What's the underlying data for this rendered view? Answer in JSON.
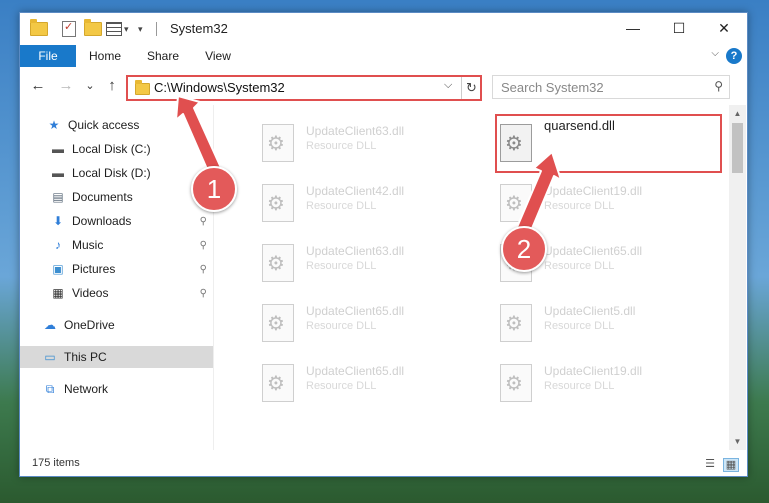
{
  "window": {
    "title": "System32"
  },
  "window_controls": {
    "minimize": "—",
    "maximize": "☐",
    "close": "✕"
  },
  "ribbon": {
    "tabs": [
      {
        "label": "File"
      },
      {
        "label": "Home"
      },
      {
        "label": "Share"
      },
      {
        "label": "View"
      }
    ],
    "help": "?",
    "expand": "⌵"
  },
  "nav": {
    "back": "←",
    "forward": "→",
    "recent": "⌄",
    "up": "↑",
    "address": "C:\\Windows\\System32",
    "dropdown": "⌵",
    "refresh": "↻",
    "search_placeholder": "Search System32",
    "search_icon": "⚲"
  },
  "sidebar": {
    "items": [
      {
        "label": "Quick access",
        "icon": "star-icon",
        "glyph": "★",
        "color": "#2f7ed8",
        "pinned": false,
        "selected": false
      },
      {
        "label": "Local Disk (C:)",
        "icon": "drive-icon",
        "glyph": "▬",
        "color": "#555555",
        "pinned": true,
        "selected": false
      },
      {
        "label": "Local Disk (D:)",
        "icon": "drive-icon",
        "glyph": "▬",
        "color": "#555555",
        "pinned": false,
        "selected": false
      },
      {
        "label": "Documents",
        "icon": "documents-icon",
        "glyph": "▤",
        "color": "#5b6a7a",
        "pinned": true,
        "selected": false
      },
      {
        "label": "Downloads",
        "icon": "downloads-icon",
        "glyph": "⬇",
        "color": "#2f7ed8",
        "pinned": true,
        "selected": false
      },
      {
        "label": "Music",
        "icon": "music-icon",
        "glyph": "♪",
        "color": "#2f7ed8",
        "pinned": true,
        "selected": false
      },
      {
        "label": "Pictures",
        "icon": "pictures-icon",
        "glyph": "▣",
        "color": "#3b8ed0",
        "pinned": true,
        "selected": false
      },
      {
        "label": "Videos",
        "icon": "videos-icon",
        "glyph": "▦",
        "color": "#333333",
        "pinned": true,
        "selected": false
      },
      {
        "label": "OneDrive",
        "icon": "cloud-icon",
        "glyph": "☁",
        "color": "#2f7ed8",
        "pinned": false,
        "selected": false
      },
      {
        "label": "This PC",
        "icon": "computer-icon",
        "glyph": "▭",
        "color": "#3b8ed0",
        "pinned": false,
        "selected": true
      },
      {
        "label": "Network",
        "icon": "network-icon",
        "glyph": "⧉",
        "color": "#2f7ed8",
        "pinned": false,
        "selected": false
      }
    ],
    "pin_glyph": "📌"
  },
  "files": [
    {
      "name": "UpdateClient63.dll",
      "type": "Resource DLL",
      "highlight": false
    },
    {
      "name": "quarsend.dll",
      "type": "",
      "highlight": true
    },
    {
      "name": "UpdateClient42.dll",
      "type": "Resource DLL",
      "highlight": false
    },
    {
      "name": "UpdateClient19.dll",
      "type": "Resource DLL",
      "highlight": false
    },
    {
      "name": "UpdateClient63.dll",
      "type": "Resource DLL",
      "highlight": false
    },
    {
      "name": "UpdateClient65.dll",
      "type": "Resource DLL",
      "highlight": false
    },
    {
      "name": "UpdateClient65.dll",
      "type": "Resource DLL",
      "highlight": false
    },
    {
      "name": "UpdateClient5.dll",
      "type": "Resource DLL",
      "highlight": false
    },
    {
      "name": "UpdateClient65.dll",
      "type": "Resource DLL",
      "highlight": false
    },
    {
      "name": "UpdateClient19.dll",
      "type": "Resource DLL",
      "highlight": false
    }
  ],
  "status": {
    "count": "175 items"
  },
  "view_icons": {
    "details": "☰",
    "tiles": "▦"
  },
  "callouts": {
    "step1": "1",
    "step2": "2"
  },
  "colors": {
    "accent": "#1979ca",
    "highlight": "#e04f4f",
    "badge": "#e35a5a"
  }
}
